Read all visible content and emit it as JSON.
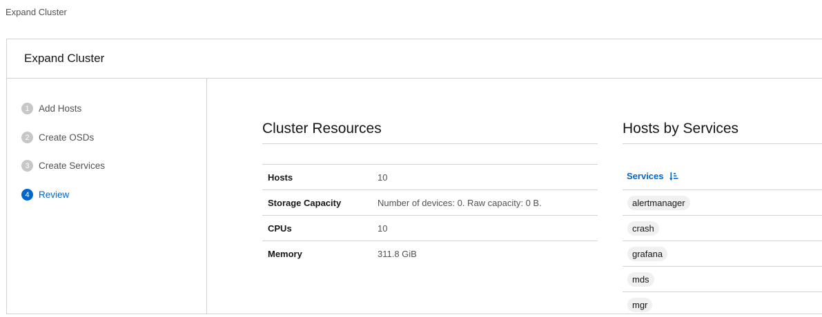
{
  "breadcrumb": "Expand Cluster",
  "card": {
    "title": "Expand Cluster"
  },
  "wizard": {
    "steps": [
      {
        "num": "1",
        "label": "Add Hosts"
      },
      {
        "num": "2",
        "label": "Create OSDs"
      },
      {
        "num": "3",
        "label": "Create Services"
      },
      {
        "num": "4",
        "label": "Review"
      }
    ],
    "active_step": "4"
  },
  "cluster_resources": {
    "title": "Cluster Resources",
    "rows": [
      {
        "key": "Hosts",
        "value": "10"
      },
      {
        "key": "Storage Capacity",
        "value": "Number of devices: 0. Raw capacity: 0 B."
      },
      {
        "key": "CPUs",
        "value": "10"
      },
      {
        "key": "Memory",
        "value": "311.8 GiB"
      }
    ]
  },
  "hosts_by_services": {
    "title": "Hosts by Services",
    "column_header": "Services",
    "sort_icon": "sort-ascending-icon",
    "services": [
      "alertmanager",
      "crash",
      "grafana",
      "mds",
      "mgr"
    ]
  },
  "colors": {
    "accent": "#0066cc",
    "border": "#d2d2d2",
    "step_inactive": "#c7c7c7",
    "chip_bg": "#f0f0f0"
  }
}
